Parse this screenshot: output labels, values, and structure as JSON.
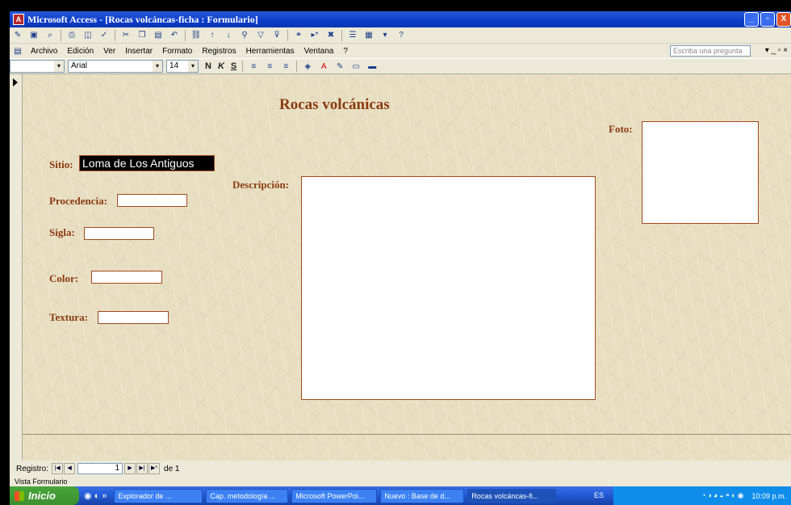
{
  "window": {
    "title": "Microsoft Access - [Rocas volcáncas-ficha : Formulario]",
    "buttons": [
      "_",
      "▫",
      "X"
    ]
  },
  "menubar": {
    "items": [
      "Archivo",
      "Edición",
      "Ver",
      "Insertar",
      "Formato",
      "Registros",
      "Herramientas",
      "Ventana",
      "?"
    ],
    "ask_placeholder": "Escriba una pregunta",
    "right_controls": "▾ _ ▫ ×"
  },
  "format_toolbar": {
    "object_combo": "",
    "font": "Arial",
    "size": "14",
    "bold": "N",
    "italic": "K",
    "underline": "S"
  },
  "form": {
    "heading": "Rocas volcánicas",
    "labels": {
      "sitio": "Sitio:",
      "procedencia": "Procedencia:",
      "sigla": "Sigla:",
      "color": "Color:",
      "textura": "Textura:",
      "descripcion": "Descripción:",
      "foto": "Foto:"
    },
    "values": {
      "sitio": "Loma de Los Antiguos",
      "procedencia": "",
      "sigla": "",
      "color": "",
      "textura": "",
      "descripcion": ""
    }
  },
  "navigation": {
    "label": "Registro:",
    "current": "1",
    "of_label": "de 1"
  },
  "status": {
    "view": "Vista Formulario"
  },
  "taskbar": {
    "start": "Inicio",
    "tasks": [
      "Explorador de ...",
      "Cap. metodología ...",
      "Microsoft PowerPoi...",
      "Nuevo : Base de d...",
      "Rocas volcáncas-fi..."
    ],
    "lang": "ES",
    "clock": "10:09 p.m."
  }
}
